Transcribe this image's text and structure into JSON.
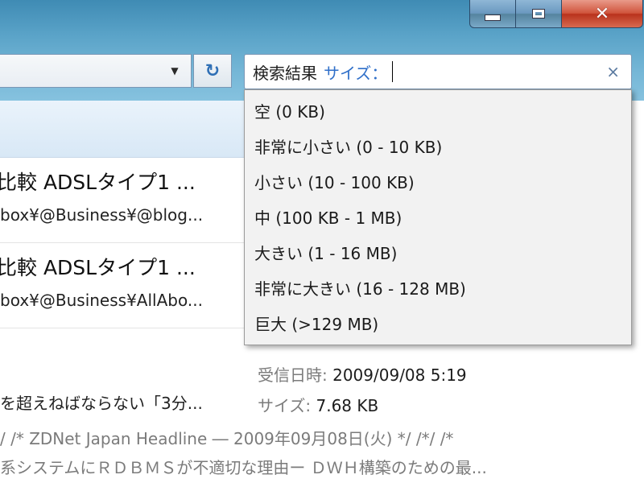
{
  "window": {
    "minimize_icon": "minimize-icon",
    "maximize_icon": "maximize-icon",
    "close_icon": "close-icon",
    "close_glyph": "✕"
  },
  "address": {
    "dropdown_glyph": "▼",
    "refresh_glyph": "↻"
  },
  "search": {
    "term": "検索結果",
    "keyword": "サイズ：",
    "clear_glyph": "×"
  },
  "size_menu": {
    "items": [
      "空 (0 KB)",
      "非常に小さい (0 - 10 KB)",
      "小さい (10 - 100 KB)",
      "中 (100 KB -  1 MB)",
      "大きい (1 - 16 MB)",
      "非常に大きい (16 - 128 MB)",
      "巨大 (>129 MB)"
    ]
  },
  "results": [
    {
      "title": "比較 ADSLタイプ1 ...",
      "path": "box¥@Business¥@blog..."
    },
    {
      "title": "比較 ADSLタイプ1 ...",
      "path": "box¥@Business¥AllAbo..."
    }
  ],
  "third_result": {
    "title": "を超えねばならない「3分...",
    "received_label": "受信日時:",
    "received_value": "2009/09/08 5:19",
    "size_label": "サイズ:",
    "size_value": "7.68 KB",
    "snippet_line1": "/ /* ZDNet Japan Headline ― 2009年09月08日(火) */ /*/ /*",
    "snippet_line2": "系システムにＲＤＢＭＳが不適切な理由ー ＤＷＨ構築のための最..."
  }
}
